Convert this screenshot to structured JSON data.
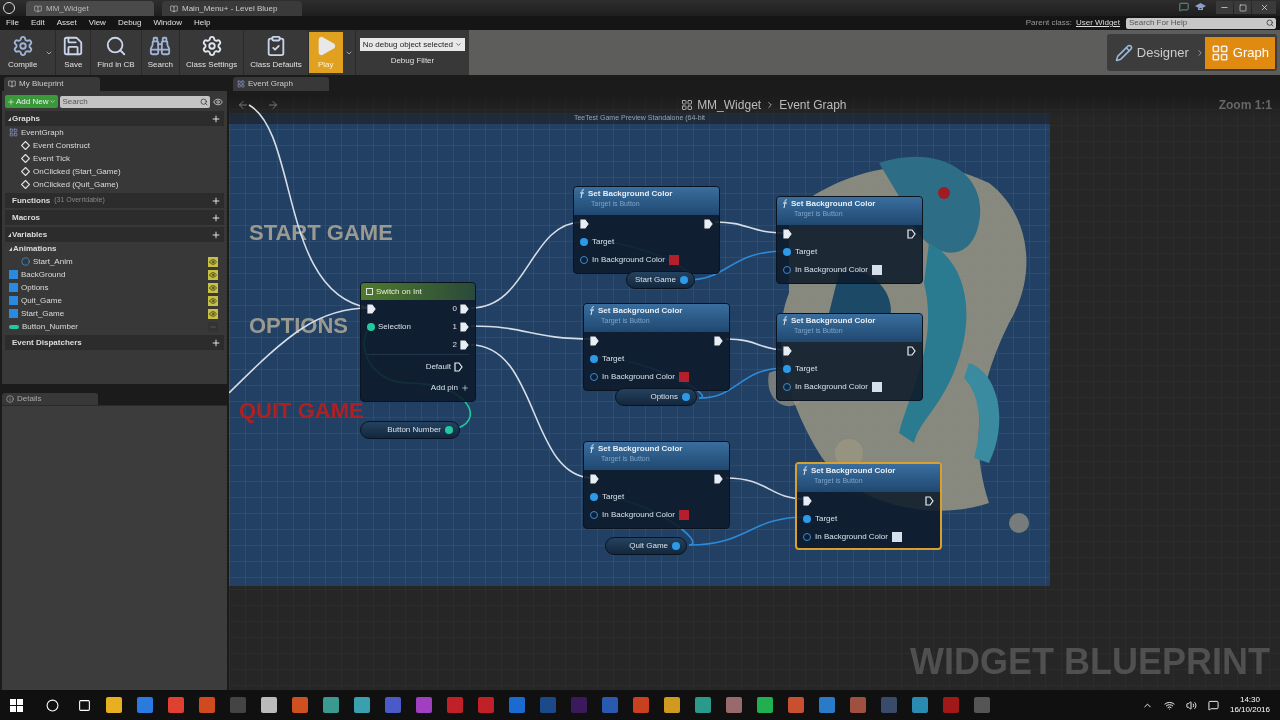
{
  "title_bar": {
    "tabs": [
      {
        "label": "MM_Widget",
        "selected": true
      },
      {
        "label": "Main_Menu+ - Level Bluep",
        "selected": false
      }
    ]
  },
  "menu": [
    "File",
    "Edit",
    "Asset",
    "View",
    "Debug",
    "Window",
    "Help"
  ],
  "parent_class": {
    "label": "Parent class:",
    "value": "User Widget"
  },
  "help_search": {
    "placeholder": "Search For Help"
  },
  "toolbar": [
    {
      "label": "Compile",
      "selected": false,
      "dropdown": true
    },
    {
      "label": "Save",
      "selected": false,
      "dropdown": false
    },
    {
      "label": "Find in CB",
      "selected": false,
      "dropdown": false
    },
    {
      "label": "Search",
      "selected": false,
      "dropdown": false
    },
    {
      "label": "Class Settings",
      "selected": false,
      "dropdown": false
    },
    {
      "label": "Class Defaults",
      "selected": false,
      "dropdown": false
    },
    {
      "label": "Play",
      "selected": true,
      "dropdown": true
    }
  ],
  "debug": {
    "value": "No debug object selected",
    "label": "Debug Filter"
  },
  "modes": [
    {
      "label": "Designer",
      "selected": false
    },
    {
      "label": "Graph",
      "selected": true
    }
  ],
  "my_blueprint": {
    "tab": "My Blueprint",
    "add_new": "Add New",
    "search": {
      "placeholder": "Search"
    },
    "sections": [
      {
        "label": "Graphs",
        "expanded": true,
        "items": [
          {
            "label": "EventGraph",
            "kind": "graph",
            "children": [
              {
                "label": "Event Construct",
                "kind": "event"
              },
              {
                "label": "Event Tick",
                "kind": "event"
              },
              {
                "label": "OnClicked (Start_Game)",
                "kind": "event"
              },
              {
                "label": "OnClicked (Quit_Game)",
                "kind": "event"
              }
            ]
          }
        ]
      },
      {
        "label": "Functions",
        "expanded": false,
        "note": "(31 Overridable)"
      },
      {
        "label": "Macros",
        "expanded": false
      },
      {
        "label": "Variables",
        "expanded": true,
        "items": [
          {
            "label": "Animations",
            "kind": "category",
            "children": [
              {
                "label": "Start_Anim",
                "kind": "animation",
                "exposed": true
              }
            ]
          },
          {
            "label": "BackGround",
            "kind": "widget",
            "exposed": true
          },
          {
            "label": "Options",
            "kind": "widget",
            "exposed": true
          },
          {
            "label": "Quit_Game",
            "kind": "widget",
            "exposed": true
          },
          {
            "label": "Start_Game",
            "kind": "widget",
            "exposed": true
          },
          {
            "label": "Button_Number",
            "kind": "integer",
            "exposed": false
          }
        ]
      },
      {
        "label": "Event Dispatchers",
        "expanded": false
      }
    ]
  },
  "details": {
    "tab": "Details"
  },
  "graph": {
    "tab": "Event Graph",
    "breadcrumb": [
      "MM_Widget",
      "Event Graph"
    ],
    "zoom": "Zoom 1:1",
    "watermark": "WIDGET BLUEPRINT",
    "preview": {
      "title": "TeeTest Game Preview Standalone (64-bit",
      "menu_items": [
        {
          "label": "START GAME",
          "color": "#9a9a90"
        },
        {
          "label": "OPTIONS",
          "color": "#9a9a90"
        },
        {
          "label": "QUIT GAME",
          "color": "#b02020"
        }
      ]
    },
    "nodes": [
      {
        "kind": "switch",
        "title": "Switch on Int",
        "input": "Selection",
        "outputs": [
          "0",
          "1",
          "2"
        ],
        "default": "Default",
        "add_pin": "Add pin"
      },
      {
        "kind": "variable",
        "label": "Button Number"
      },
      {
        "kind": "function",
        "title": "Set Background Color",
        "subtitle": "Target is Button",
        "target": "Target",
        "color_label": "In Background Color",
        "color": "#b3202c",
        "selected": false
      },
      {
        "kind": "variable",
        "label": "Start Game"
      },
      {
        "kind": "function",
        "title": "Set Background Color",
        "subtitle": "Target is Button",
        "target": "Target",
        "color_label": "In Background Color",
        "color": "#b3202c",
        "selected": false
      },
      {
        "kind": "variable",
        "label": "Options"
      },
      {
        "kind": "function",
        "title": "Set Background Color",
        "subtitle": "Target is Button",
        "target": "Target",
        "color_label": "In Background Color",
        "color": "#b3202c",
        "selected": false
      },
      {
        "kind": "variable",
        "label": "Quit Game"
      },
      {
        "kind": "function",
        "title": "Set Background Color",
        "subtitle": "Target is Button",
        "target": "Target",
        "color_label": "In Background Color",
        "color": "#d6e0ec",
        "selected": false
      },
      {
        "kind": "function",
        "title": "Set Background Color",
        "subtitle": "Target is Button",
        "target": "Target",
        "color_label": "In Background Color",
        "color": "#d6e0ec",
        "selected": false
      },
      {
        "kind": "function",
        "title": "Set Background Color",
        "subtitle": "Target is Button",
        "target": "Target",
        "color_label": "In Background Color",
        "color": "#d6e0ec",
        "selected": true
      }
    ]
  },
  "taskbar": {
    "time": "14:30",
    "date": "16/10/2016"
  }
}
